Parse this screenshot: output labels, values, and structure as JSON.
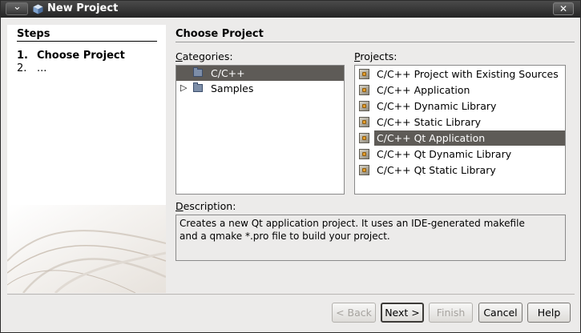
{
  "window": {
    "title": "New Project"
  },
  "steps": {
    "heading": "Steps",
    "items": [
      {
        "num": "1.",
        "label": "Choose Project"
      },
      {
        "num": "2.",
        "label": "..."
      }
    ]
  },
  "content": {
    "title": "Choose Project",
    "categories": {
      "label_u": "C",
      "label_rest": "ategories:",
      "items": [
        {
          "label": "C/C++",
          "selected": true,
          "expandable": false
        },
        {
          "label": "Samples",
          "selected": false,
          "expandable": true
        }
      ]
    },
    "projects": {
      "label_u": "P",
      "label_rest": "rojects:",
      "items": [
        {
          "label": "C/C++ Project with Existing Sources",
          "selected": false
        },
        {
          "label": "C/C++ Application",
          "selected": false
        },
        {
          "label": "C/C++ Dynamic Library",
          "selected": false
        },
        {
          "label": "C/C++ Static Library",
          "selected": false
        },
        {
          "label": "C/C++ Qt Application",
          "selected": true
        },
        {
          "label": "C/C++ Qt Dynamic Library",
          "selected": false
        },
        {
          "label": "C/C++ Qt Static Library",
          "selected": false
        }
      ]
    },
    "description": {
      "label_u": "D",
      "label_rest": "escription:",
      "text_line1": "Creates a new Qt application project. It uses an IDE-generated makefile",
      "text_line2": "and a qmake *.pro file to build your project."
    }
  },
  "buttons": {
    "back": "< Back",
    "next": "Next >",
    "finish": "Finish",
    "cancel": "Cancel",
    "help": "Help"
  },
  "colors": {
    "selection": "#5e5b57",
    "window_bg": "#ecebea",
    "titlebar": "#2e2e2e"
  },
  "icons": {
    "title_menu": "chevron-down-icon",
    "close": "close-icon",
    "folder": "folder-icon",
    "project": "project-icon",
    "tree_expand": "triangle-right-icon"
  }
}
